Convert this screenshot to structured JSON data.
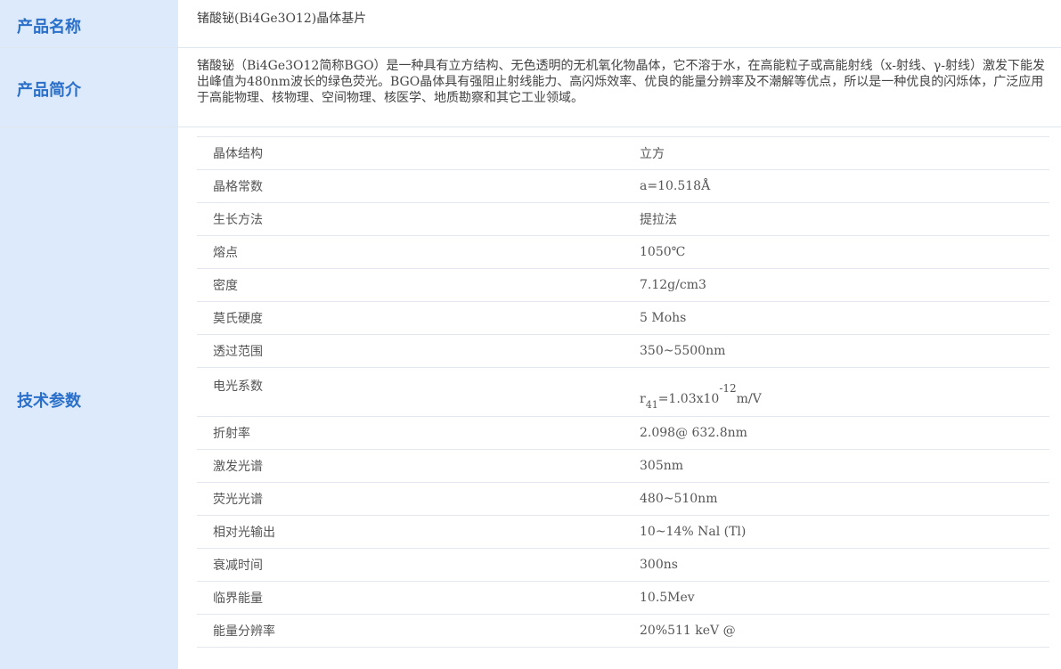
{
  "product_name": {
    "label": "产品名称",
    "value": "锗酸铋(Bi4Ge3O12)晶体基片"
  },
  "product_intro": {
    "label": "产品简介",
    "text": "锗酸铋（Bi4Ge3O12简称BGO）是一种具有立方结构、无色透明的无机氧化物晶体，它不溶于水，在高能粒子或高能射线（x-射线、γ-射线）激发下能发出峰值为480nm波长的绿色荧光。BGO晶体具有强阻止射线能力、高闪烁效率、优良的能量分辨率及不潮解等优点，所以是一种优良的闪烁体，广泛应用于高能物理、核物理、空间物理、核医学、地质勘察和其它工业领域。"
  },
  "tech_params": {
    "label": "技术参数",
    "rows": [
      {
        "name": "晶体结构",
        "value": "立方"
      },
      {
        "name": "晶格常数",
        "value": "a=10.518Å"
      },
      {
        "name": "生长方法",
        "value": "提拉法"
      },
      {
        "name": "熔点",
        "value": "1050℃"
      },
      {
        "name": "密度",
        "value": "7.12g/cm3"
      },
      {
        "name": "莫氏硬度",
        "value": "5 Mohs"
      },
      {
        "name": "透过范围",
        "value": "350~5500nm"
      },
      {
        "name": "电光系数",
        "value_parts": {
          "base": "r",
          "sub": "41",
          "mid": "=1.03x10",
          "sup": "-12",
          "unit": "m/V"
        }
      },
      {
        "name": "折射率",
        "value": "2.098@ 632.8nm"
      },
      {
        "name": "激发光谱",
        "value": "305nm"
      },
      {
        "name": "荧光光谱",
        "value": "480~510nm"
      },
      {
        "name": "相对光输出",
        "value": "10~14% Nal (Tl)"
      },
      {
        "name": "衰减时间",
        "value": "300ns"
      },
      {
        "name": "临界能量",
        "value": "10.5Mev"
      },
      {
        "name": "能量分辨率",
        "value": "20%511 keV @"
      }
    ]
  }
}
